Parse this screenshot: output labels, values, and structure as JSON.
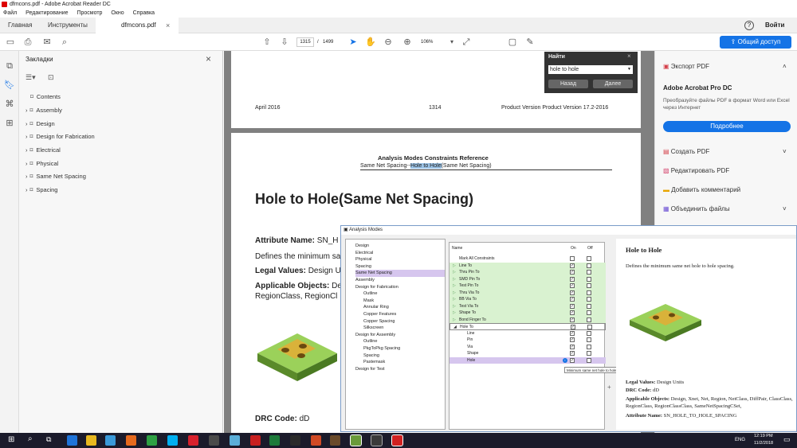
{
  "window": {
    "title": "dfmcons.pdf - Adobe Acrobat Reader DC"
  },
  "menu": [
    "Файл",
    "Редактирование",
    "Просмотр",
    "Окно",
    "Справка"
  ],
  "tabs": {
    "home": "Главная",
    "tools": "Инструменты",
    "doc": "dfmcons.pdf",
    "doc_close": "×"
  },
  "account": {
    "help": "?",
    "signin": "Войти",
    "share": "Общий доступ"
  },
  "toolbar": {
    "page_current": "1315",
    "page_sep": "/",
    "page_total": "1499",
    "zoom": "106%"
  },
  "bookmarks": {
    "title": "Закладки",
    "items": [
      "Contents",
      "Assembly",
      "Design",
      "Design for Fabrication",
      "Electrical",
      "Physical",
      "Same Net Spacing",
      "Spacing"
    ]
  },
  "find": {
    "title": "Найти",
    "query": "hole to hole",
    "back": "Назад",
    "next": "Далее"
  },
  "doc": {
    "header_date": "April 2016",
    "header_page": "1314",
    "header_version": "Product Version Product Version 17.2-2016",
    "ref_title": "Analysis Modes Constraints Reference",
    "ref_sub_pre": "Same Net Spacing--",
    "ref_sub_hl": "Hole to Hole",
    "ref_sub_post": "(Same Net Spacing)",
    "heading": "Hole to Hole(Same Net Spacing)",
    "attr_label": "Attribute Name:",
    "attr_val": "SN_H",
    "defines": "Defines the minimum sa",
    "legal_label": "Legal Values:",
    "legal_val": "Design U",
    "applic_label": "Applicable Objects:",
    "applic_val": "De",
    "applic_val2": "RegionClass, RegionCl",
    "drc_label": "DRC Code:",
    "drc_val": "dD"
  },
  "rightpanel": {
    "export": "Экспорт PDF",
    "product": "Adobe Acrobat Pro DC",
    "desc": "Преобразуйте файлы PDF в формат Word или Excel через Интернет",
    "more": "Подробнее",
    "tools": [
      "Создать PDF",
      "Редактировать PDF",
      "Добавить комментарий",
      "Объединить файлы"
    ]
  },
  "analysis": {
    "title": "Analysis Modes",
    "tree": [
      "Design",
      "Electrical",
      "Physical",
      "Spacing",
      "Same Net Spacing",
      "Assembly",
      "Design for Fabrication",
      "Outline",
      "Mask",
      "Annular Ring",
      "Copper Features",
      "Copper Spacing",
      "Silkscreen",
      "Design for Assembly",
      "Outline",
      "PkgToPkg Spacing",
      "Spacing",
      "Pastemask",
      "Design for Test"
    ],
    "grid_headers": {
      "name": "Name",
      "on": "On",
      "off": "Off"
    },
    "rows": [
      "Mark All Constraints",
      "Line To",
      "Thru Pin To",
      "SMD Pin To",
      "Test Pin To",
      "Thru Via To",
      "BB Via To",
      "Test Via To",
      "Shape To",
      "Bond Finger To",
      "Hole To",
      "Line",
      "Pin",
      "Via",
      "Shape",
      "Hole"
    ],
    "tooltip": "Minimum same net hole to hole spacing(SN_HOLE_TO_HOLE_SPACING)",
    "help_title": "Hole to Hole",
    "help_desc": "Defines the minimum same net hole to hole spacing.",
    "help_legal_l": "Legal Values:",
    "help_legal_v": "Design Units",
    "help_drc_l": "DRC Code:",
    "help_drc_v": "dD",
    "help_app_l": "Applicable Objects:",
    "help_app_v": "Design, Xnet, Net, Region, NetClass, DiffPair, ClassClass, RegionClass, RegionClassClass, SameNetSpacingCSet,",
    "help_attr_l": "Attribute Name:",
    "help_attr_v": "SN_HOLE_TO_HOLE_SPACING"
  },
  "tray": {
    "lang": "ENG",
    "time": "12:19 PM",
    "date": "11/2/2018"
  },
  "colors": {
    "accent": "#1473e6",
    "selection": "#d6c6ee",
    "row_green": "#d9f2d0"
  }
}
